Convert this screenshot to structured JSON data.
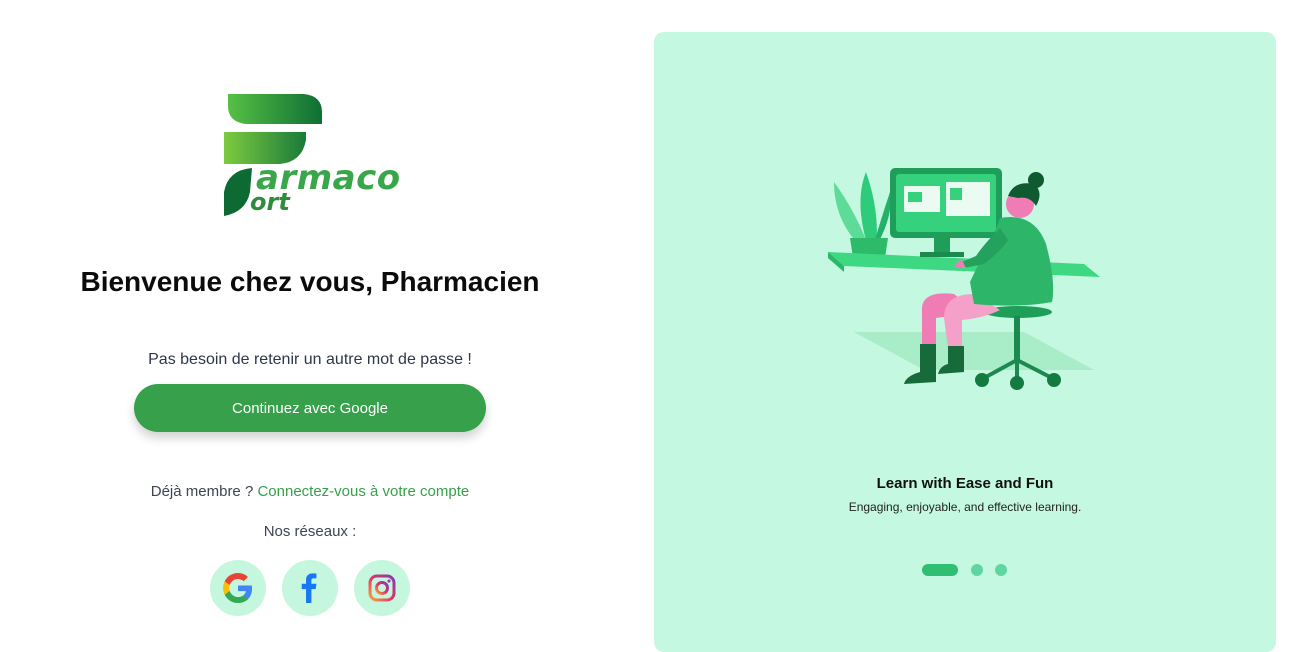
{
  "logo": {
    "text_main": "armaco",
    "text_sub": "ort"
  },
  "welcome": {
    "title": "Bienvenue chez vous, Pharmacien"
  },
  "login": {
    "subtitle": "Pas besoin de retenir un autre mot de passe !",
    "google_button_label": "Continuez avec Google",
    "member_prefix": "Déjà membre ?",
    "member_link": "Connectez-vous à votre compte",
    "networks_label": "Nos réseaux :"
  },
  "social": [
    {
      "name": "google",
      "icon": "google-icon"
    },
    {
      "name": "facebook",
      "icon": "facebook-icon"
    },
    {
      "name": "instagram",
      "icon": "instagram-icon"
    }
  ],
  "carousel": {
    "title": "Learn with Ease and Fun",
    "subtitle": "Engaging, enjoyable, and effective learning.",
    "slide_count": 3,
    "active_slide": 1
  },
  "colors": {
    "primary": "#36a04a",
    "panel_bg": "#c4f8e0",
    "social_bg": "#c5f7df",
    "dot": "#5fd6a1",
    "dot_active": "#2fbf73"
  }
}
